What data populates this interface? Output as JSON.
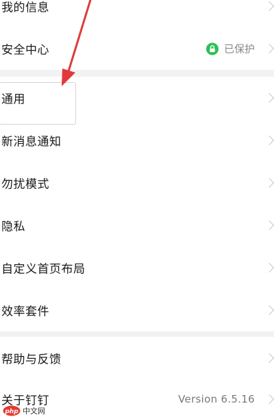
{
  "settings": {
    "items": [
      {
        "label": "我的信息"
      },
      {
        "label": "安全中心",
        "status": "已保护"
      },
      {
        "label": "通用"
      },
      {
        "label": "新消息通知"
      },
      {
        "label": "勿扰模式"
      },
      {
        "label": "隐私"
      },
      {
        "label": "自定义首页布局"
      },
      {
        "label": "效率套件"
      },
      {
        "label": "帮助与反馈"
      },
      {
        "label": "关于钉钉",
        "version": "Version 6.5.16"
      }
    ]
  },
  "watermark": {
    "text": "中文网",
    "logo": "php"
  },
  "colors": {
    "accent_green": "#2dbf5a",
    "arrow_red": "#e03a3a",
    "chevron": "#c8c8c8",
    "section_gap": "#f2f2f2"
  },
  "icons": {
    "lock": "lock-icon",
    "chevron": "chevron-right-icon"
  }
}
